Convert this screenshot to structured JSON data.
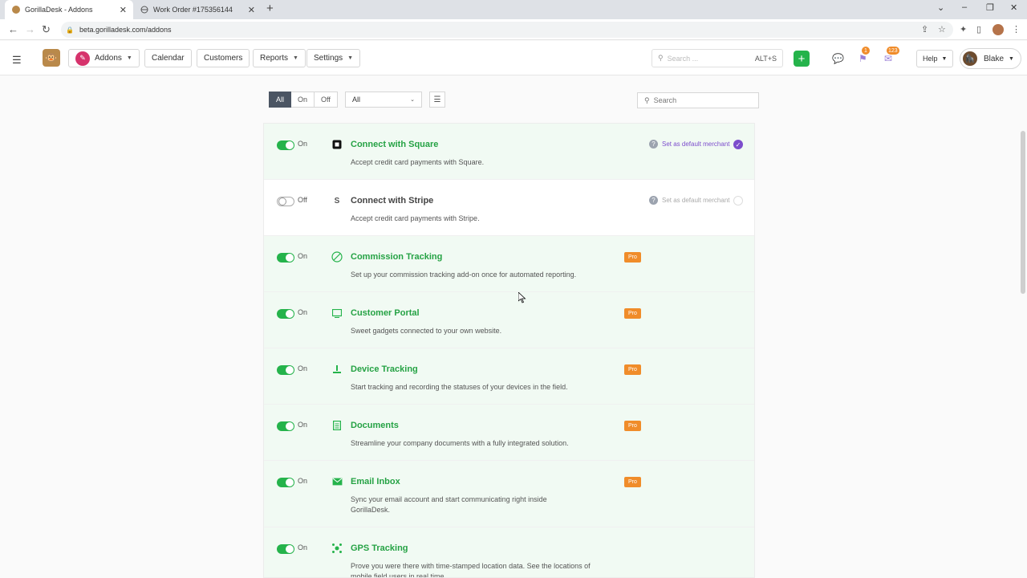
{
  "browser": {
    "tabs": [
      {
        "title": "GorillaDesk - Addons",
        "icon": "gorilla-favicon",
        "active": true
      },
      {
        "title": "Work Order #175356144",
        "icon": "globe-icon",
        "active": false
      }
    ],
    "url": "beta.gorilladesk.com/addons"
  },
  "header": {
    "nav": {
      "addons": "Addons",
      "calendar": "Calendar",
      "customers": "Customers",
      "reports": "Reports",
      "settings": "Settings"
    },
    "search": {
      "placeholder": "Search ...",
      "shortcut": "ALT+S"
    },
    "badges": {
      "notifications": "1",
      "messages": "123"
    },
    "help": "Help",
    "user": "Blake"
  },
  "filters": {
    "segments": [
      "All",
      "On",
      "Off"
    ],
    "active_segment": "All",
    "category": "All",
    "search_placeholder": "Search"
  },
  "addons": [
    {
      "name": "Connect with Square",
      "desc": "Accept credit card payments with Square.",
      "status": "On",
      "icon": "square-icon",
      "merchant": "Set as default merchant",
      "merchant_selected": true
    },
    {
      "name": "Connect with Stripe",
      "desc": "Accept credit card payments with Stripe.",
      "status": "Off",
      "icon": "stripe-icon",
      "merchant": "Set as default merchant",
      "merchant_selected": false
    },
    {
      "name": "Commission Tracking",
      "desc": "Set up your commission tracking add-on once for automated reporting.",
      "status": "On",
      "icon": "commission-icon",
      "badge": "Pro"
    },
    {
      "name": "Customer Portal",
      "desc": "Sweet gadgets connected to your own website.",
      "status": "On",
      "icon": "portal-icon",
      "badge": "Pro"
    },
    {
      "name": "Device Tracking",
      "desc": "Start tracking and recording the statuses of your devices in the field.",
      "status": "On",
      "icon": "device-icon",
      "badge": "Pro"
    },
    {
      "name": "Documents",
      "desc": "Streamline your company documents with a fully integrated solution.",
      "status": "On",
      "icon": "document-icon",
      "badge": "Pro"
    },
    {
      "name": "Email Inbox",
      "desc": "Sync your email account and start communicating right inside GorillaDesk.",
      "status": "On",
      "icon": "email-icon",
      "badge": "Pro"
    },
    {
      "name": "GPS Tracking",
      "desc": "Prove you were there with time-stamped location data. See the locations of mobile field users in real time.",
      "status": "On",
      "icon": "gps-icon"
    }
  ],
  "colors": {
    "accent": "#25b34b",
    "pro": "#f08c2a",
    "merchant": "#7c4dcc"
  }
}
